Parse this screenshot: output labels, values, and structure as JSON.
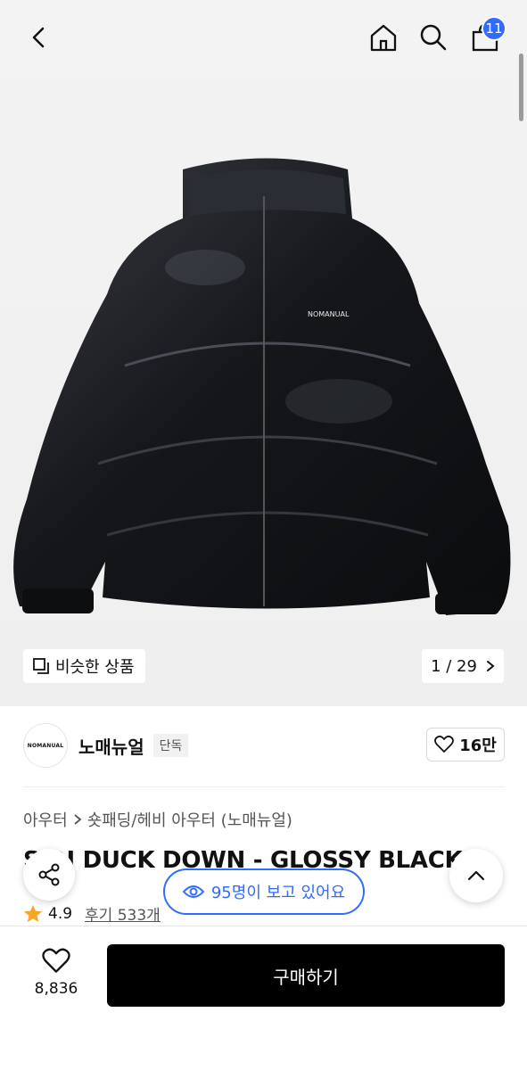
{
  "header": {
    "back_icon": "chevron-left-icon",
    "home_icon": "home-icon",
    "search_icon": "search-icon",
    "cart_icon": "cart-icon",
    "cart_count": "11",
    "accent_color": "#2f6bff"
  },
  "gallery": {
    "jacket_logo_text": "NOMANUAL",
    "similar_label": "비슷한 상품",
    "page_indicator": "1 / 29"
  },
  "brand": {
    "logo_text": "NOMANUAL",
    "name": "노매뉴얼",
    "badge": "단독",
    "likes": "16만"
  },
  "product": {
    "breadcrumb": [
      "아우터",
      "숏패딩/헤비 아우터 (노매뉴얼)"
    ],
    "title": "S  DI DUCK DOWN - GLOSSY BLACK",
    "rating": "4.9",
    "reviews": "후기 533개",
    "viewers": "95명이 보고 있어요"
  },
  "bottom": {
    "wish_count": "8,836",
    "buy_label": "구매하기"
  }
}
